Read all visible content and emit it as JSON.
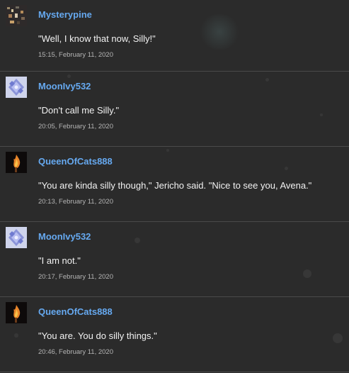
{
  "posts": [
    {
      "username": "Mysterypine",
      "avatar": "mysterypine-avatar",
      "message": "\"Well, I know that now, Silly!\"",
      "timestamp": "15:15, February 11, 2020"
    },
    {
      "username": "MoonIvy532",
      "avatar": "moonivy-avatar",
      "message": "\"Don't call me Silly.\"",
      "timestamp": "20:05, February 11, 2020"
    },
    {
      "username": "QueenOfCats888",
      "avatar": "queenofcats-avatar",
      "message": "\"You are kinda silly though,\" Jericho said. \"Nice to see you, Avena.\"",
      "timestamp": "20:13, February 11, 2020"
    },
    {
      "username": "MoonIvy532",
      "avatar": "moonivy-avatar",
      "message": "\"I am not.\"",
      "timestamp": "20:17, February 11, 2020"
    },
    {
      "username": "QueenOfCats888",
      "avatar": "queenofcats-avatar",
      "message": "\"You are. You do silly things.\"",
      "timestamp": "20:46, February 11, 2020"
    }
  ],
  "colors": {
    "background": "#2b2b2b",
    "username": "#66a9f0",
    "message": "#f2f2f2",
    "timestamp": "#b5b5b5",
    "divider": "#4a4a4a"
  }
}
